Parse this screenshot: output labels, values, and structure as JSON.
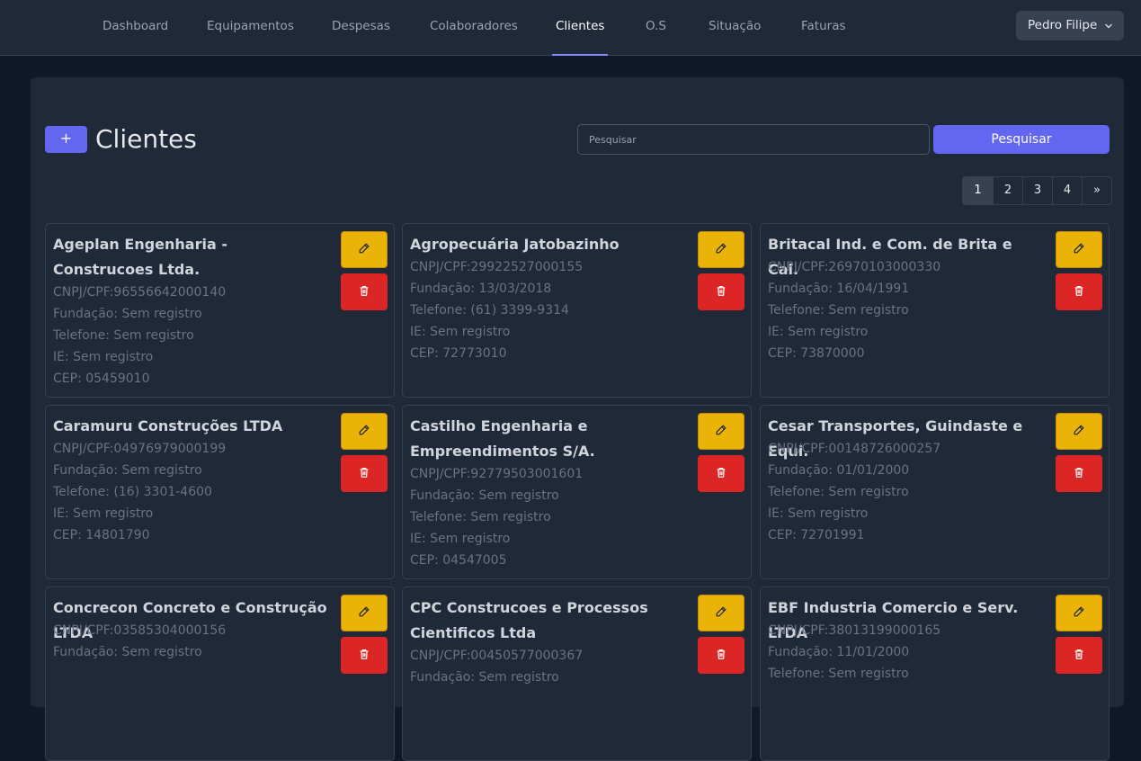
{
  "nav": {
    "items": [
      "Dashboard",
      "Equipamentos",
      "Despesas",
      "Colaboradores",
      "Clientes",
      "O.S",
      "Situação",
      "Faturas"
    ],
    "active": "Clientes",
    "user_name": "Pedro Filipe"
  },
  "page": {
    "add_label": "+",
    "title": "Clientes",
    "search_placeholder": "Pesquisar",
    "search_button": "Pesquisar"
  },
  "pagination": {
    "pages": [
      "1",
      "2",
      "3",
      "4"
    ],
    "next": "»",
    "current": "1"
  },
  "colors": {
    "accent": "#6366f1",
    "edit": "#eab308",
    "delete": "#dc2626"
  },
  "icons": {
    "edit": "pencil-icon",
    "delete": "trash-icon"
  },
  "clients": [
    {
      "name": "Ageplan Engenharia - Construcoes Ltda.",
      "cnpj": "CNPJ/CPF:96556642000140",
      "fundacao": "Fundação: Sem registro",
      "telefone": "Telefone: Sem registro",
      "ie": "IE: Sem registro",
      "cep": "CEP: 05459010"
    },
    {
      "name": "Agropecuária Jatobazinho",
      "cnpj": "CNPJ/CPF:29922527000155",
      "fundacao": "Fundação: 13/03/2018",
      "telefone": "Telefone: (61) 3399-9314",
      "ie": "IE: Sem registro",
      "cep": "CEP: 72773010"
    },
    {
      "name": "Britacal Ind. e Com. de Brita e Cal.",
      "cnpj": "CNPJ/CPF:26970103000330",
      "fundacao": "Fundação: 16/04/1991",
      "telefone": "Telefone: Sem registro",
      "ie": "IE: Sem registro",
      "cep": "CEP: 73870000"
    },
    {
      "name": "Caramuru Construções LTDA",
      "cnpj": "CNPJ/CPF:04976979000199",
      "fundacao": "Fundação: Sem registro",
      "telefone": "Telefone: (16) 3301-4600",
      "ie": "IE: Sem registro",
      "cep": "CEP: 14801790"
    },
    {
      "name": "Castilho Engenharia e Empreendimentos S/A.",
      "cnpj": "CNPJ/CPF:92779503001601",
      "fundacao": "Fundação: Sem registro",
      "telefone": "Telefone: Sem registro",
      "ie": "IE: Sem registro",
      "cep": "CEP: 04547005"
    },
    {
      "name": "Cesar Transportes, Guindaste e Equi.",
      "cnpj": "CNPJ/CPF:00148726000257",
      "fundacao": "Fundação: 01/01/2000",
      "telefone": "Telefone: Sem registro",
      "ie": "IE: Sem registro",
      "cep": "CEP: 72701991"
    },
    {
      "name": "Concrecon Concreto e Construção LTDA",
      "cnpj": "CNPJ/CPF:03585304000156",
      "fundacao": "Fundação: Sem registro",
      "telefone": "",
      "ie": "",
      "cep": ""
    },
    {
      "name": "CPC Construcoes e Processos Cientificos Ltda",
      "cnpj": "CNPJ/CPF:00450577000367",
      "fundacao": "Fundação: Sem registro",
      "telefone": "",
      "ie": "",
      "cep": ""
    },
    {
      "name": "EBF Industria Comercio e Serv. LTDA",
      "cnpj": "CNPJ/CPF:38013199000165",
      "fundacao": "Fundação: 11/01/2000",
      "telefone": "Telefone: Sem registro",
      "ie": "",
      "cep": ""
    }
  ]
}
